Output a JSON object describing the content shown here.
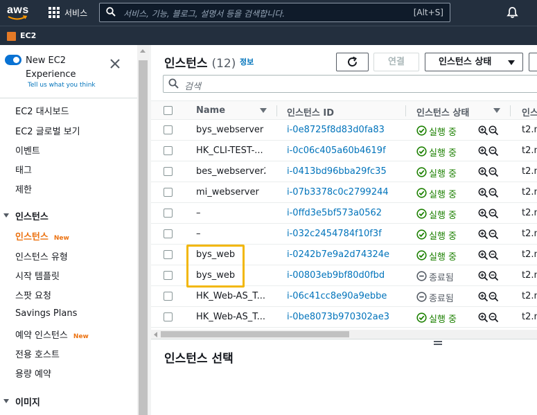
{
  "topnav": {
    "logo_text": "aws",
    "services_label": "서비스",
    "search_placeholder": "서비스, 기능, 블로그, 설명서 등을 검색합니다.",
    "search_shortcut": "[Alt+S]"
  },
  "subnav": {
    "service_label": "EC2"
  },
  "sidebar": {
    "new_experience_label": "New EC2 Experience",
    "tell_us_label": "Tell us what you think",
    "items": [
      {
        "label": "EC2 대시보드"
      },
      {
        "label": "EC2 글로벌 보기"
      },
      {
        "label": "이벤트"
      },
      {
        "label": "태그"
      },
      {
        "label": "제한"
      }
    ],
    "instances_section": "인스턴스",
    "instances_items": [
      {
        "label": "인스턴스",
        "badge": "New",
        "active": true
      },
      {
        "label": "인스턴스 유형"
      },
      {
        "label": "시작 템플릿"
      },
      {
        "label": "스팟 요청"
      },
      {
        "label": "Savings Plans"
      },
      {
        "label": "예약 인스턴스",
        "badge": "New"
      },
      {
        "label": "전용 호스트"
      },
      {
        "label": "용량 예약"
      }
    ],
    "images_section": "이미지"
  },
  "main": {
    "title": "인스턴스",
    "count": "(12)",
    "info_link": "정보",
    "connect_label": "연결",
    "state_button_label": "인스턴스 상태",
    "filter_placeholder": "검색",
    "columns": {
      "name": "Name",
      "id": "인스턴스 ID",
      "state": "인스턴스 상태",
      "type": "인스"
    },
    "rows": [
      {
        "name": "bys_webserver",
        "id": "i-0e8725f8d83d0fa83",
        "state": "실행 중",
        "status": "running",
        "type": "t2.m"
      },
      {
        "name": "HK_CLI-TEST-...",
        "id": "i-0c06c405a60b4619f",
        "state": "실행 중",
        "status": "running",
        "type": "t2.m"
      },
      {
        "name": "bes_webserver2",
        "id": "i-0413bd96bba29fc35",
        "state": "실행 중",
        "status": "running",
        "type": "t2.m"
      },
      {
        "name": "mi_webserver",
        "id": "i-07b3378c0c2799244",
        "state": "실행 중",
        "status": "running",
        "type": "t2.m"
      },
      {
        "name": "–",
        "id": "i-0ffd3e5bf573a0562",
        "state": "실행 중",
        "status": "running",
        "type": "t2.m"
      },
      {
        "name": "–",
        "id": "i-032c2454784f10f3f",
        "state": "실행 중",
        "status": "running",
        "type": "t2.m"
      },
      {
        "name": "bys_web",
        "id": "i-0242b7e9a2d74324e",
        "state": "실행 중",
        "status": "running",
        "type": "t2.m"
      },
      {
        "name": "bys_web",
        "id": "i-00803eb9bf80d0fbd",
        "state": "종료됨",
        "status": "terminated",
        "type": "t2.m"
      },
      {
        "name": "HK_Web-AS_T...",
        "id": "i-06c41cc8e90a9ebbe",
        "state": "종료됨",
        "status": "terminated",
        "type": "t2.m"
      },
      {
        "name": "HK_Web-AS_T...",
        "id": "i-0be8073b970302ae3",
        "state": "실행 중",
        "status": "running",
        "type": "t2.m"
      }
    ],
    "select_title": "인스턴스 선택"
  },
  "colors": {
    "running": "#1d8102",
    "terminated": "#545b64",
    "link": "#0073bb",
    "accent": "#ec7211",
    "highlight": "#f2b707"
  }
}
